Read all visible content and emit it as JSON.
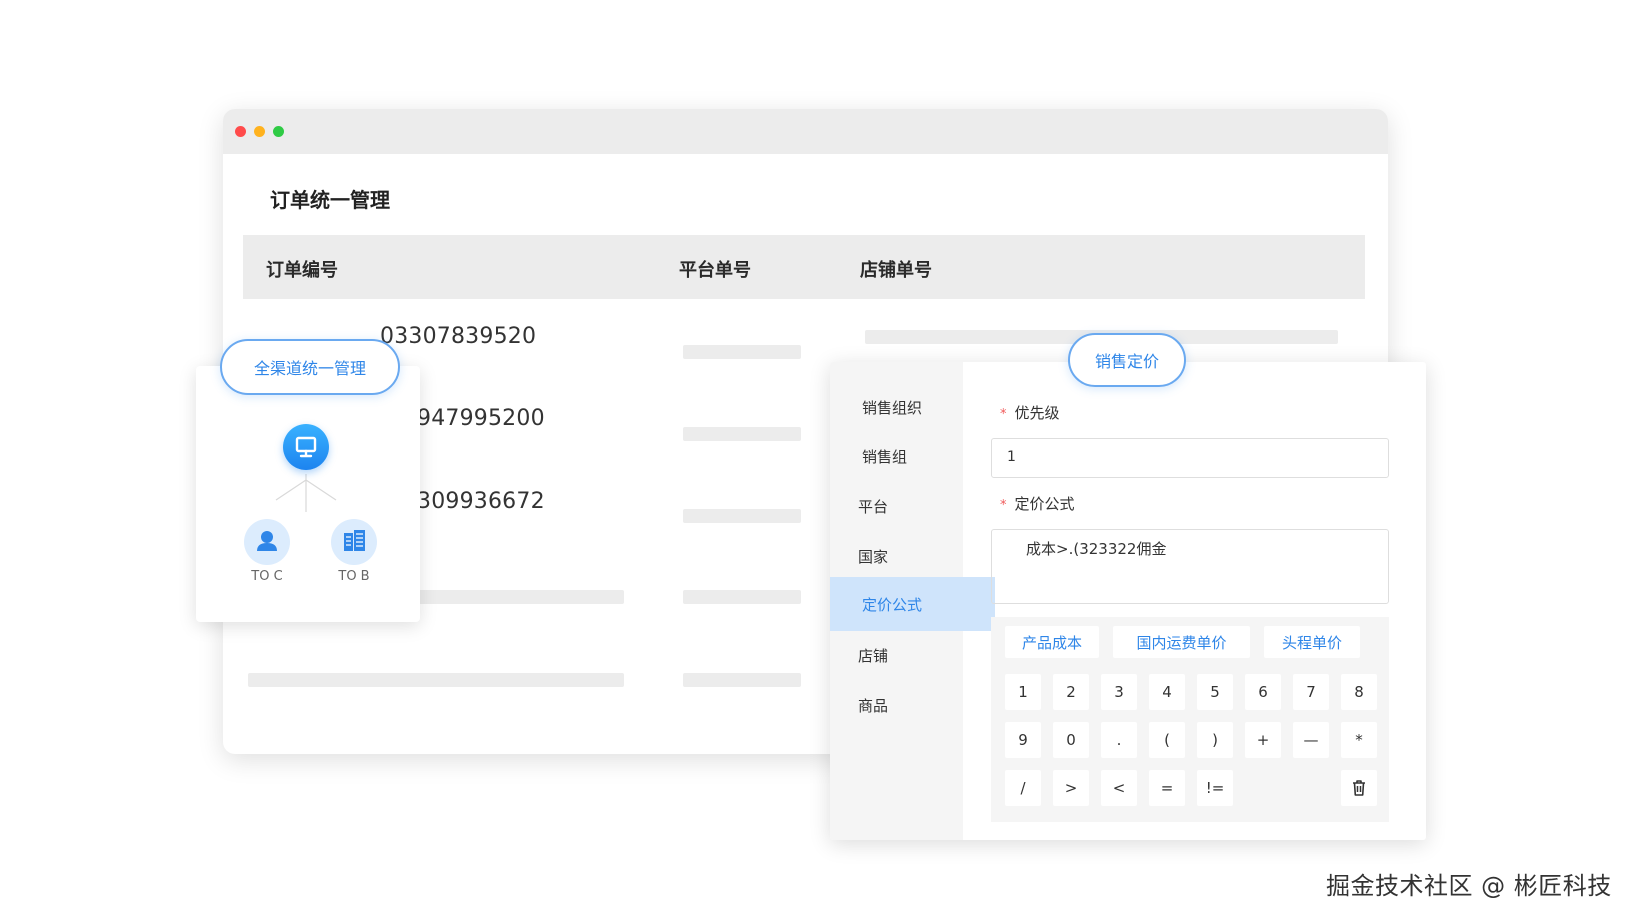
{
  "page": {
    "title": "订单统一管理"
  },
  "table": {
    "headers": [
      "订单编号",
      "平台单号",
      "店铺单号"
    ],
    "visible_order_fragments": [
      "03307839520",
      "947995200",
      "309936672"
    ]
  },
  "channel_card": {
    "badge": "全渠道统一管理",
    "hub_icon": "monitor-icon",
    "nodes": [
      {
        "label": "TO C",
        "icon": "user-icon"
      },
      {
        "label": "TO B",
        "icon": "building-icon"
      }
    ]
  },
  "pricing": {
    "badge": "销售定价",
    "menu": [
      "销售组织",
      "销售组",
      "平台",
      "国家",
      "定价公式",
      "店铺",
      "商品"
    ],
    "active_menu": "定价公式",
    "priority_label": "优先级",
    "priority_value": "1",
    "formula_label": "定价公式",
    "formula_value": "成本>.(323322佣金",
    "required_mark": "*",
    "variables": [
      "产品成本",
      "国内运费单价",
      "头程单价"
    ],
    "keys_row1": [
      "1",
      "2",
      "3",
      "4",
      "5",
      "6",
      "7",
      "8"
    ],
    "keys_row2": [
      "9",
      "0",
      ".",
      "(",
      ")",
      "+",
      "—",
      "*"
    ],
    "keys_row3": [
      "/",
      ">",
      "<",
      "=",
      "!="
    ],
    "delete_icon": "trash-icon"
  },
  "watermark": "掘金技术社区 @ 彬匠科技",
  "colors": {
    "accent": "#2f86e8",
    "active_bg": "#cfe4fb",
    "dot_red": "#ff4b4b",
    "dot_yellow": "#ffb21e",
    "dot_green": "#2fcb45"
  }
}
